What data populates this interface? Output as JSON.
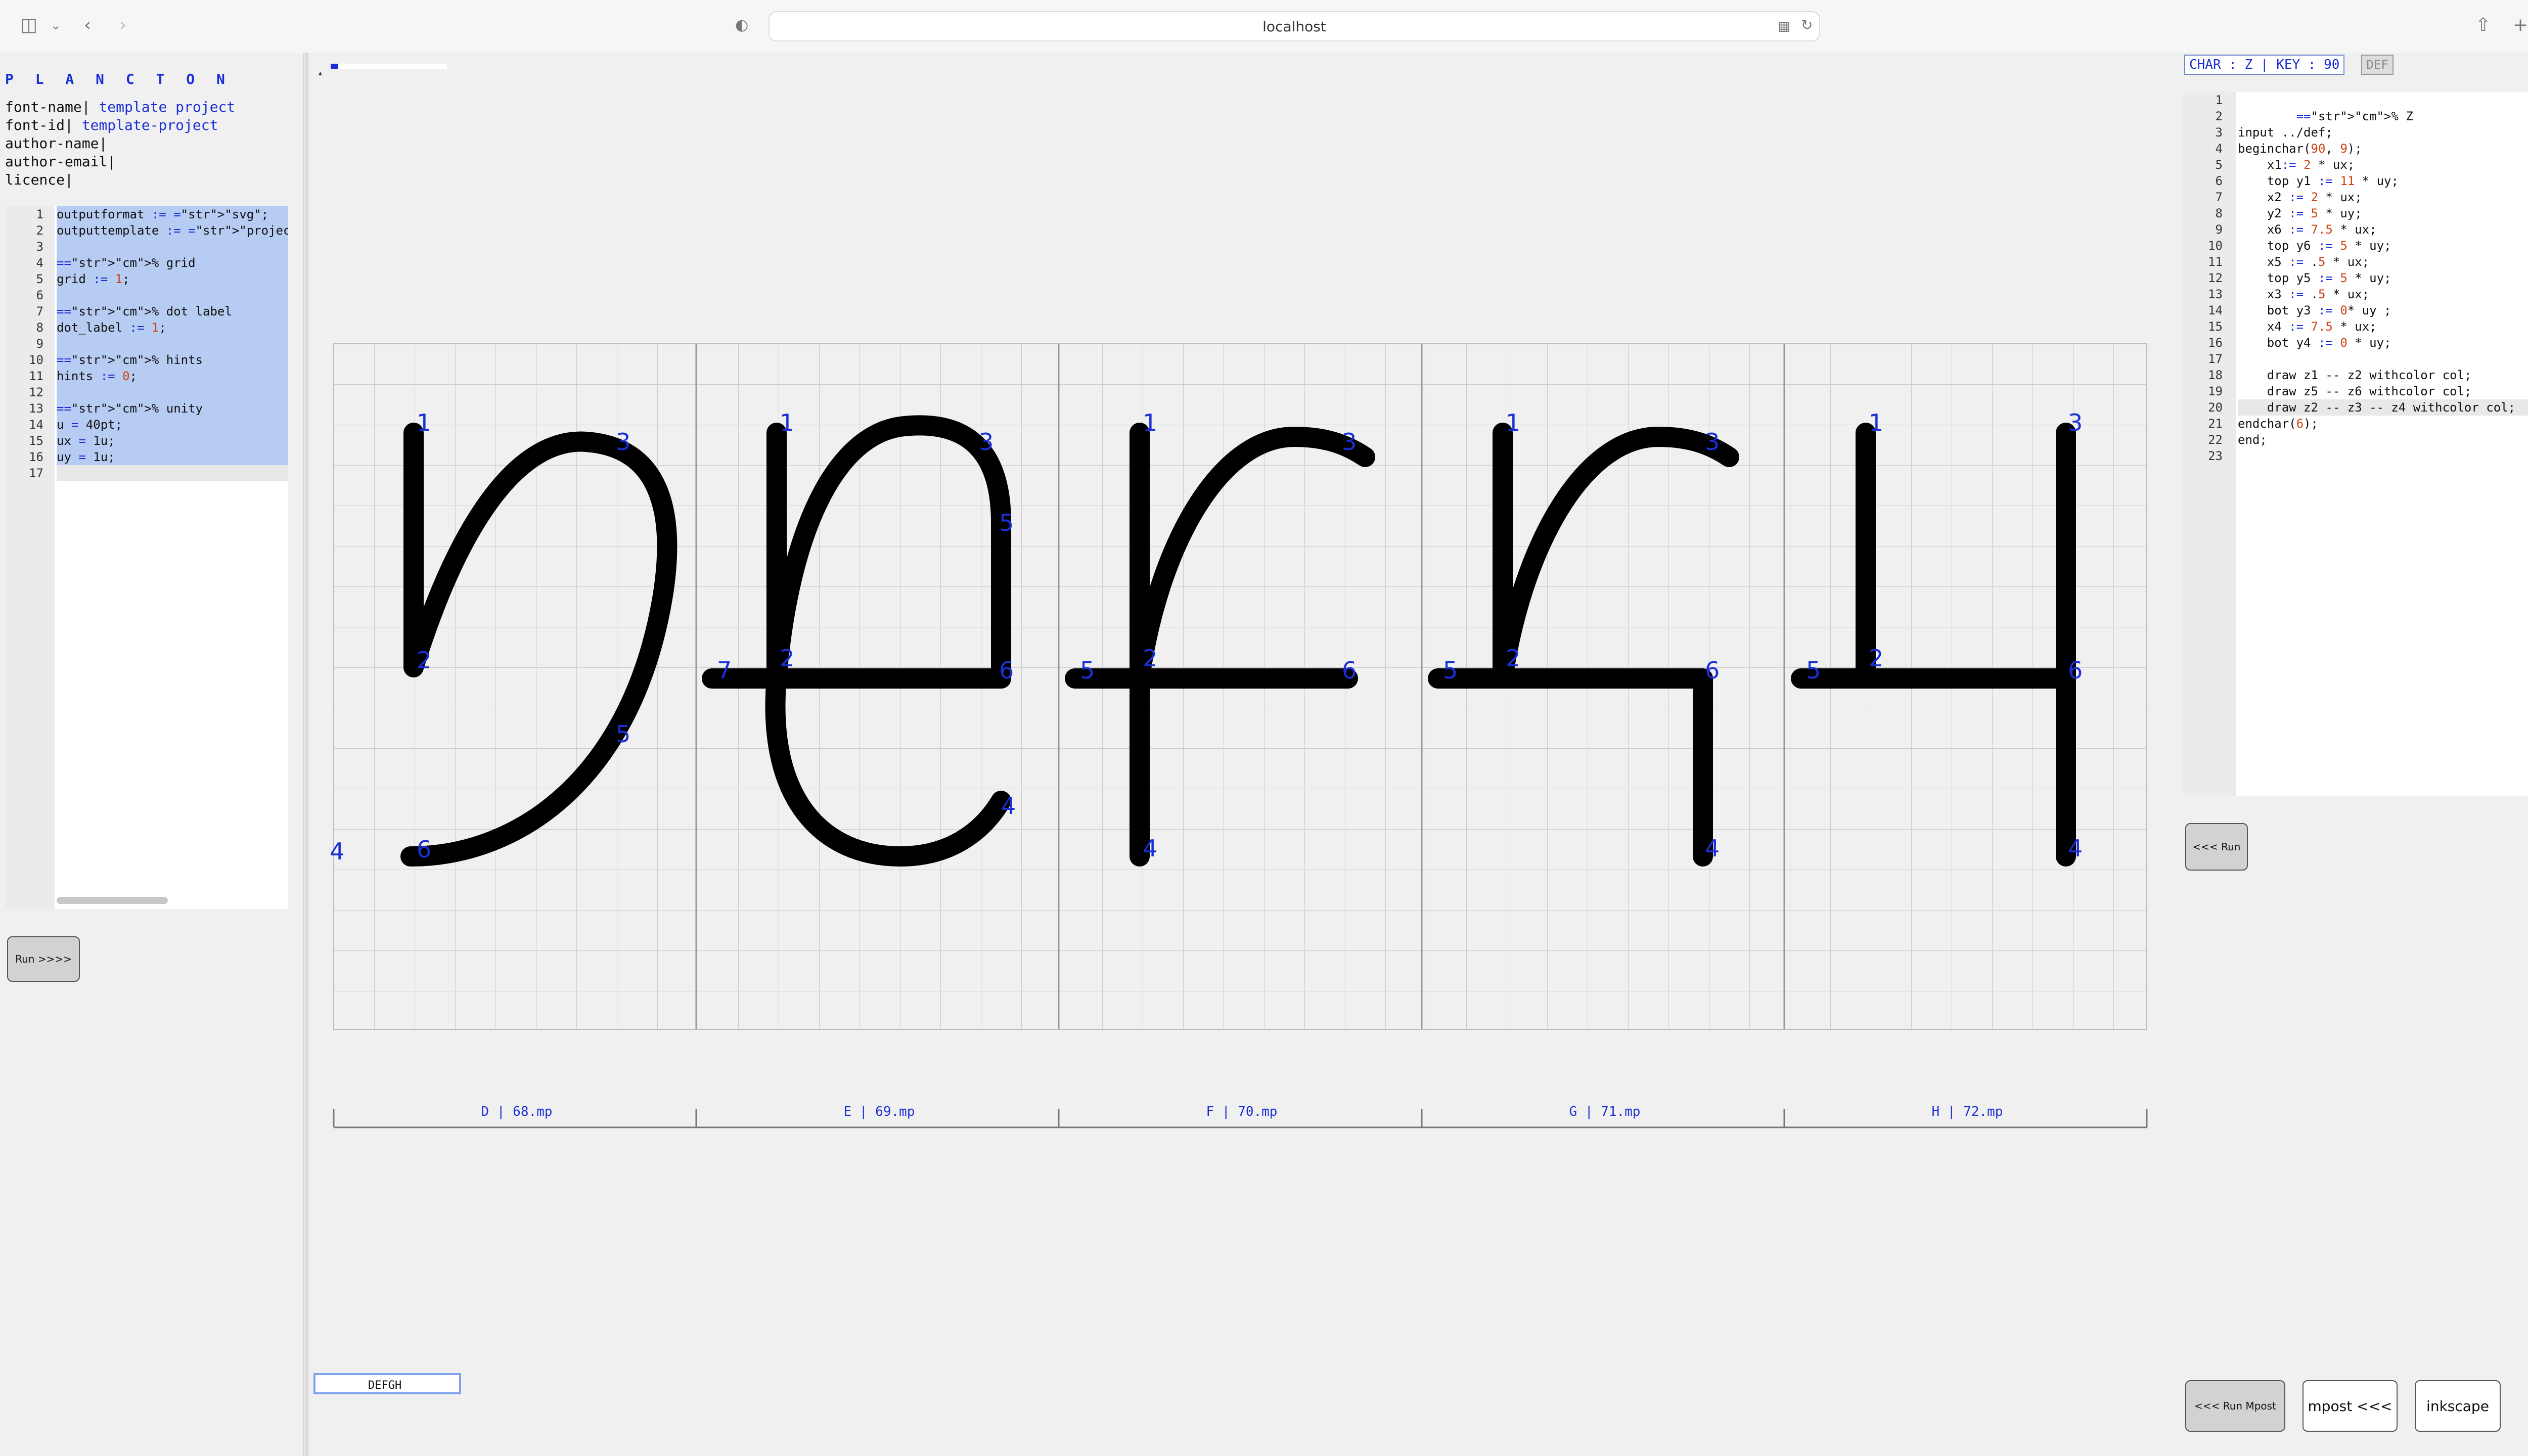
{
  "browser": {
    "url": "localhost",
    "icons": [
      "sidebar-icon",
      "chevron-down-icon",
      "back-icon",
      "forward-icon",
      "reader-icon",
      "translate-icon",
      "reload-icon",
      "share-icon",
      "new-tab-icon",
      "tabs-icon"
    ]
  },
  "left_panel": {
    "brand": "P L A N C T O N",
    "meta": [
      {
        "key": "font-name|",
        "value": " template project"
      },
      {
        "key": "font-id|",
        "value": " template-project"
      },
      {
        "key": "author-name|",
        "value": ""
      },
      {
        "key": "author-email|",
        "value": ""
      },
      {
        "key": "licence|",
        "value": ""
      }
    ],
    "editor_lines": [
      "outputformat := \"svg\";",
      "outputtemplate := \"projects/temp",
      "",
      "% grid",
      "grid := 1;",
      "",
      "% dot label",
      "dot_label := 1;",
      "",
      "% hints",
      "hints := 0;",
      "",
      "% unity",
      "u = 40pt;",
      "ux = 1u;",
      "uy = 1u;",
      ""
    ],
    "run_button": "Run >>>>"
  },
  "center": {
    "string_input": "DEFGH",
    "glyph_labels": [
      "D | 68.mp",
      "E | 69.mp",
      "F | 70.mp",
      "G | 71.mp",
      "H | 72.mp"
    ],
    "point_labels": {
      "D": [
        "1",
        "2",
        "3",
        "4",
        "5",
        "6"
      ],
      "E": [
        "1",
        "2",
        "3",
        "4",
        "5",
        "6",
        "7"
      ],
      "F": [
        "1",
        "2",
        "3",
        "4",
        "5",
        "6"
      ],
      "G": [
        "1",
        "2",
        "3",
        "4",
        "5",
        "6"
      ],
      "H": [
        "1",
        "2",
        "3",
        "4",
        "5",
        "6"
      ]
    }
  },
  "right_panel": {
    "char_info": "CHAR : Z | KEY : 90",
    "def_button": "DEF",
    "editor_lines": [
      "",
      "        % Z",
      "input ../def;",
      "beginchar(90, 9);",
      "    x1:= 2 * ux;",
      "    top y1 := 11 * uy;",
      "    x2 := 2 * ux;",
      "    y2 := 5 * uy;",
      "    x6 := 7.5 * ux;",
      "    top y6 := 5 * uy;",
      "    x5 := .5 * ux;",
      "    top y5 := 5 * uy;",
      "    x3 := .5 * ux;",
      "    bot y3 := 0* uy ;",
      "    x4 := 7.5 * ux;",
      "    bot y4 := 0 * uy;",
      "",
      "    draw z1 -- z2 withcolor col;",
      "    draw z5 -- z6 withcolor col;",
      "    draw z2 -- z3 -- z4 withcolor col;",
      "endchar(6);",
      "end;",
      ""
    ],
    "run_back_button": "<<< Run",
    "run_mpost_button": "<<< Run Mpost",
    "mpost_button": "mpost <<<",
    "inkscape_button": "inkscape"
  }
}
